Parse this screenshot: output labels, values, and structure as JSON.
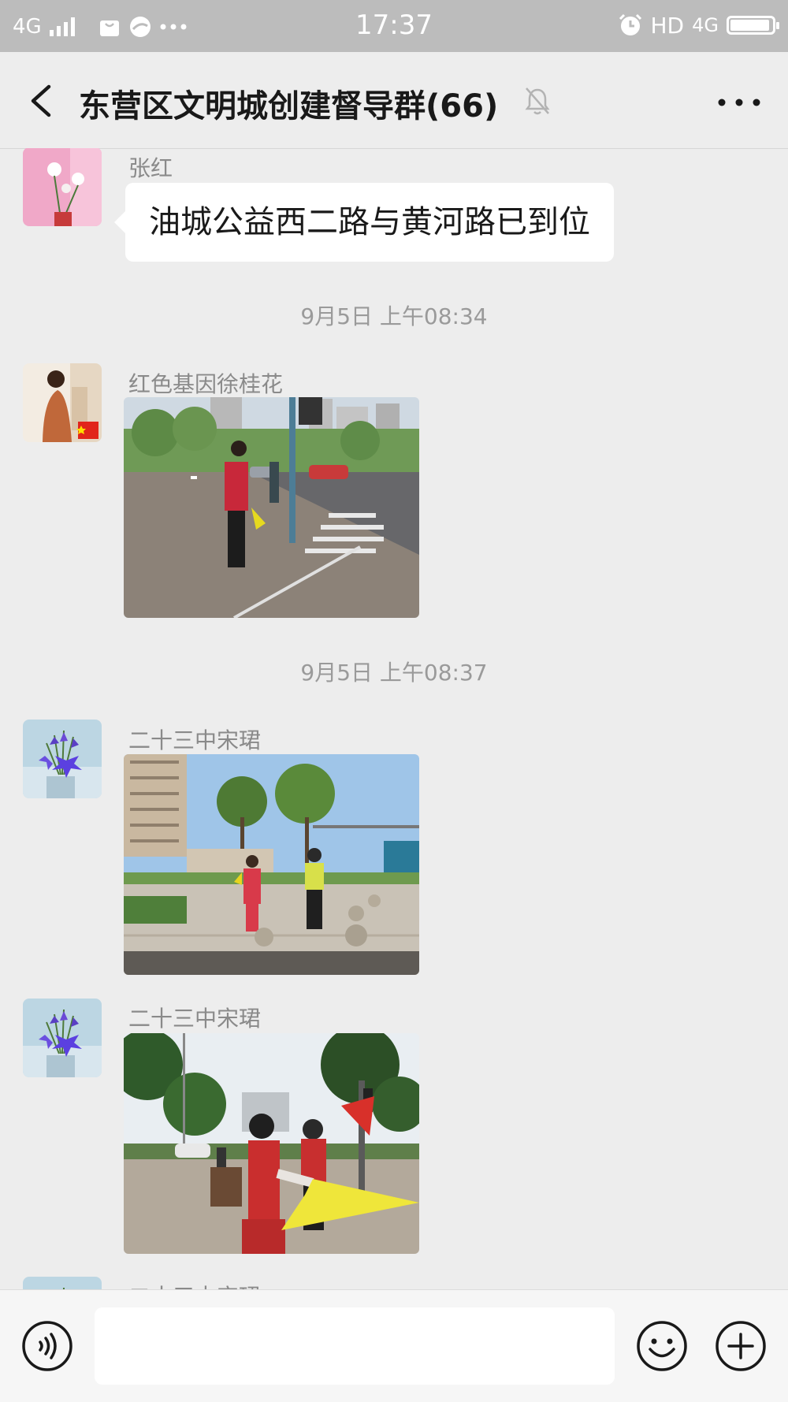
{
  "status_bar": {
    "network": "4G",
    "time": "17:37",
    "hd": "HD",
    "network_right": "4G",
    "battery_level_pct": 95
  },
  "header": {
    "title": "东营区文明城创建督导群(66)"
  },
  "messages": {
    "m1": {
      "sender": "张红",
      "text": "油城公益西二路与黄河路已到位"
    },
    "t1": "9月5日 上午08:34",
    "m2": {
      "sender": "红色基因徐桂花"
    },
    "t2": "9月5日 上午08:37",
    "m3": {
      "sender": "二十三中宋珺"
    },
    "m4": {
      "sender": "二十三中宋珺"
    },
    "m5": {
      "sender": "二十三中宋珺"
    }
  },
  "input": {
    "value": ""
  },
  "colors": {
    "background": "#ededed",
    "status_bar": "#bcbcbc",
    "bubble": "#ffffff"
  }
}
